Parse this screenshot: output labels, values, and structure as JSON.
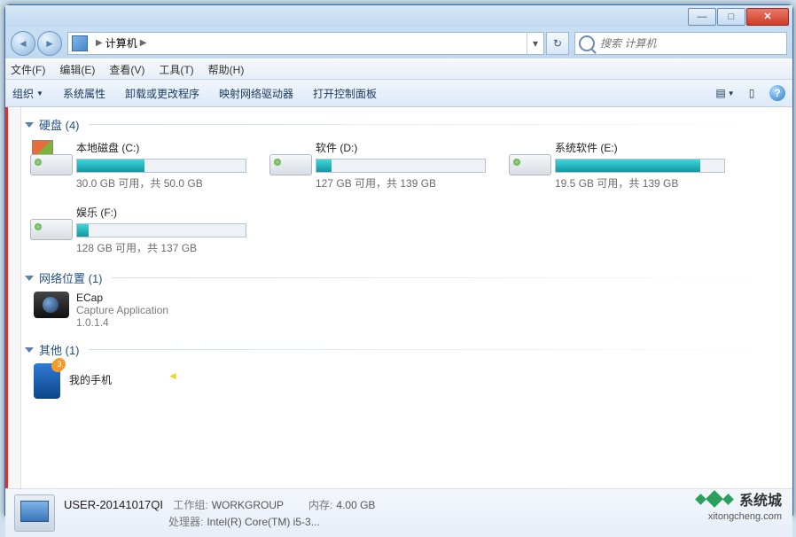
{
  "titlebar": {
    "min": "—",
    "max": "□",
    "close": "✕"
  },
  "breadcrumb": {
    "root": "计算机",
    "sep": "▶",
    "dropdown": "▾",
    "refresh": "↻"
  },
  "search": {
    "placeholder": "搜索 计算机"
  },
  "menubar": {
    "file": "文件(F)",
    "edit": "编辑(E)",
    "view": "查看(V)",
    "tools": "工具(T)",
    "help": "帮助(H)"
  },
  "toolbar": {
    "organize": "组织",
    "sysprops": "系统属性",
    "uninstall": "卸载或更改程序",
    "mapdrive": "映射网络驱动器",
    "ctrlpanel": "打开控制面板",
    "help": "?"
  },
  "groups": {
    "hdd": {
      "title": "硬盘 (4)"
    },
    "net": {
      "title": "网络位置 (1)"
    },
    "other": {
      "title": "其他 (1)"
    }
  },
  "drives": [
    {
      "name": "本地磁盘 (C:)",
      "stat": "30.0 GB 可用，共 50.0 GB",
      "fill": 40,
      "win": true
    },
    {
      "name": "软件 (D:)",
      "stat": "127 GB 可用，共 139 GB",
      "fill": 9,
      "win": false
    },
    {
      "name": "系统软件 (E:)",
      "stat": "19.5 GB 可用，共 139 GB",
      "fill": 86,
      "win": false
    },
    {
      "name": "娱乐 (F:)",
      "stat": "128 GB 可用，共 137 GB",
      "fill": 7,
      "win": false
    }
  ],
  "net_items": [
    {
      "name": "ECap",
      "line2": "Capture Application",
      "line3": "1.0.1.4"
    }
  ],
  "other_items": [
    {
      "name": "我的手机",
      "badge": "3"
    }
  ],
  "details": {
    "name": "USER-20141017QI",
    "wg_label": "工作组:",
    "wg": "WORKGROUP",
    "mem_label": "内存:",
    "mem": "4.00 GB",
    "cpu_label": "处理器:",
    "cpu": "Intel(R) Core(TM) i5-3..."
  },
  "watermark": {
    "text": "系统城",
    "url": "xitongcheng.com"
  }
}
